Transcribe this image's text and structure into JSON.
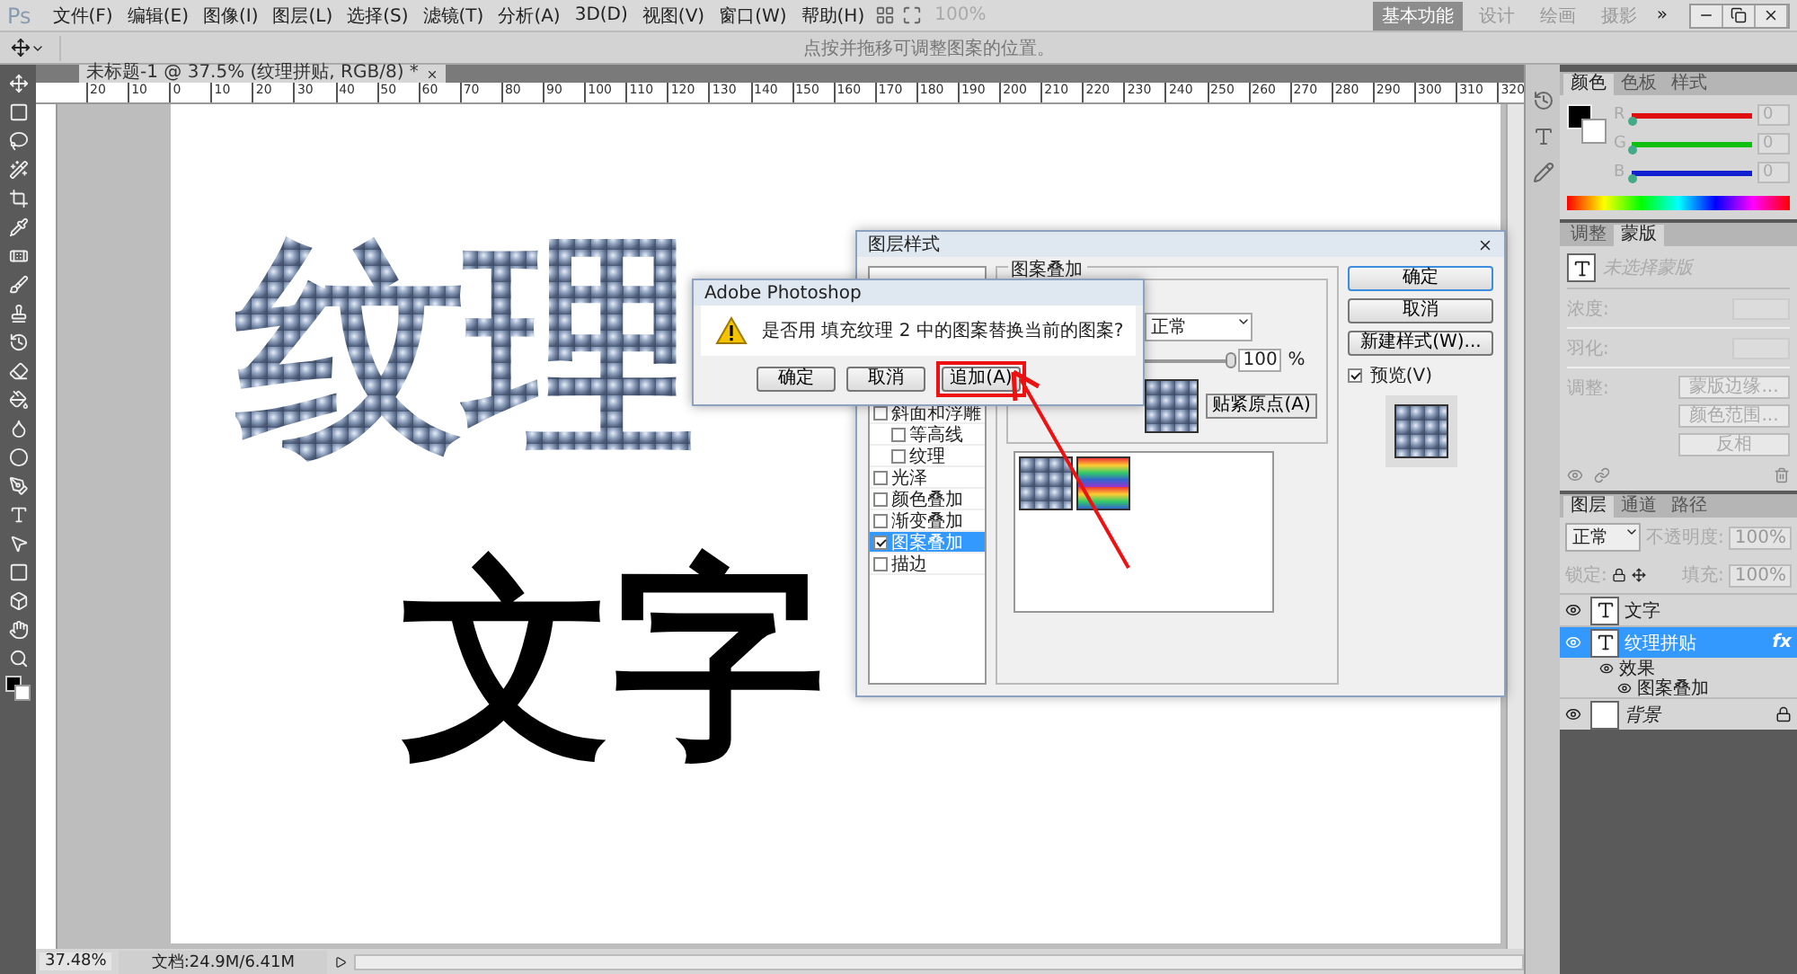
{
  "menubar": {
    "logo": "Ps",
    "menus": [
      "文件(F)",
      "编辑(E)",
      "图像(I)",
      "图层(L)",
      "选择(S)",
      "滤镜(T)",
      "分析(A)",
      "3D(D)",
      "视图(V)",
      "窗口(W)",
      "帮助(H)"
    ],
    "zoom": "100%",
    "workspaces": [
      {
        "label": "基本功能",
        "selected": true
      },
      {
        "label": "设计",
        "selected": false
      },
      {
        "label": "绘画",
        "selected": false
      },
      {
        "label": "摄影",
        "selected": false
      }
    ],
    "more": "»"
  },
  "options_bar": {
    "hint": "点按并拖移可调整图案的位置。"
  },
  "document": {
    "tab": "未标题-1 @ 37.5% (纹理拼贴, RGB/8) *",
    "ruler_labels": [
      "20",
      "10",
      "0",
      "10",
      "20",
      "30",
      "40",
      "50",
      "60",
      "70",
      "80",
      "90",
      "100",
      "110",
      "120",
      "130",
      "140",
      "150",
      "160",
      "170",
      "180",
      "190",
      "200",
      "210",
      "220",
      "230",
      "240",
      "250",
      "260",
      "270",
      "280",
      "290",
      "300",
      "310",
      "320"
    ],
    "canvas_lines": [
      {
        "text": "纹理",
        "kind": "textured"
      },
      {
        "text": "文字",
        "kind": "solid"
      }
    ]
  },
  "status_bar": {
    "zoom": "37.48%",
    "doc_info": "文档:24.9M/6.41M"
  },
  "color_panel": {
    "tabs": [
      {
        "label": "颜色",
        "selected": true
      },
      {
        "label": "色板",
        "selected": false
      },
      {
        "label": "样式",
        "selected": false
      }
    ],
    "channels": [
      {
        "name": "R",
        "value": "0",
        "level": 0,
        "color": "#e01010"
      },
      {
        "name": "G",
        "value": "0",
        "level": 0,
        "color": "#10c010"
      },
      {
        "name": "B",
        "value": "0",
        "level": 0,
        "color": "#1020d0"
      }
    ]
  },
  "masks_panel": {
    "tabs": [
      {
        "label": "调整",
        "selected": false
      },
      {
        "label": "蒙版",
        "selected": true
      }
    ],
    "selection": "未选择蒙版",
    "fields": [
      "浓度:",
      "羽化:"
    ],
    "refine_label": "调整:",
    "buttons": [
      "蒙版边缘...",
      "颜色范围...",
      "反相"
    ]
  },
  "layers_panel": {
    "tabs": [
      {
        "label": "图层",
        "selected": true
      },
      {
        "label": "通道",
        "selected": false
      },
      {
        "label": "路径",
        "selected": false
      }
    ],
    "blend_mode": "正常",
    "opacity_label": "不透明度:",
    "opacity": "100%",
    "lock_label": "锁定:",
    "fill_label": "填充:",
    "fill": "100%",
    "layers": [
      {
        "name": "文字",
        "kind": "text",
        "selected": false
      },
      {
        "name": "纹理拼贴",
        "kind": "text",
        "selected": true,
        "fx": "fx",
        "effects_label": "效果",
        "effects": [
          "图案叠加"
        ]
      },
      {
        "name": "背景",
        "kind": "background",
        "selected": false
      }
    ]
  },
  "layer_style_dialog": {
    "title": "图层样式",
    "styles": [
      {
        "label": "斜面和浮雕",
        "checked": false,
        "selected": false,
        "children": [
          {
            "label": "等高线",
            "checked": false,
            "selected": false
          },
          {
            "label": "纹理",
            "checked": false,
            "selected": false
          }
        ]
      },
      {
        "label": "光泽",
        "checked": false,
        "selected": false
      },
      {
        "label": "颜色叠加",
        "checked": false,
        "selected": false
      },
      {
        "label": "渐变叠加",
        "checked": false,
        "selected": false
      },
      {
        "label": "图案叠加",
        "checked": true,
        "selected": true
      },
      {
        "label": "描边",
        "checked": false,
        "selected": false
      }
    ],
    "group_title": "图案叠加",
    "blend_mode": "正常",
    "opacity": "100",
    "opacity_unit": "%",
    "opacity_slider": {
      "level": 1
    },
    "snap_button": "贴紧原点(A)",
    "buttons": [
      "确定",
      "取消",
      "新建样式(W)..."
    ],
    "preview": {
      "label": "预览(V)",
      "checked": true
    }
  },
  "alert": {
    "title": "Adobe Photoshop",
    "message": "是否用 填充纹理 2 中的图案替换当前的图案?",
    "buttons": [
      "确定",
      "取消",
      "追加(A)"
    ]
  }
}
